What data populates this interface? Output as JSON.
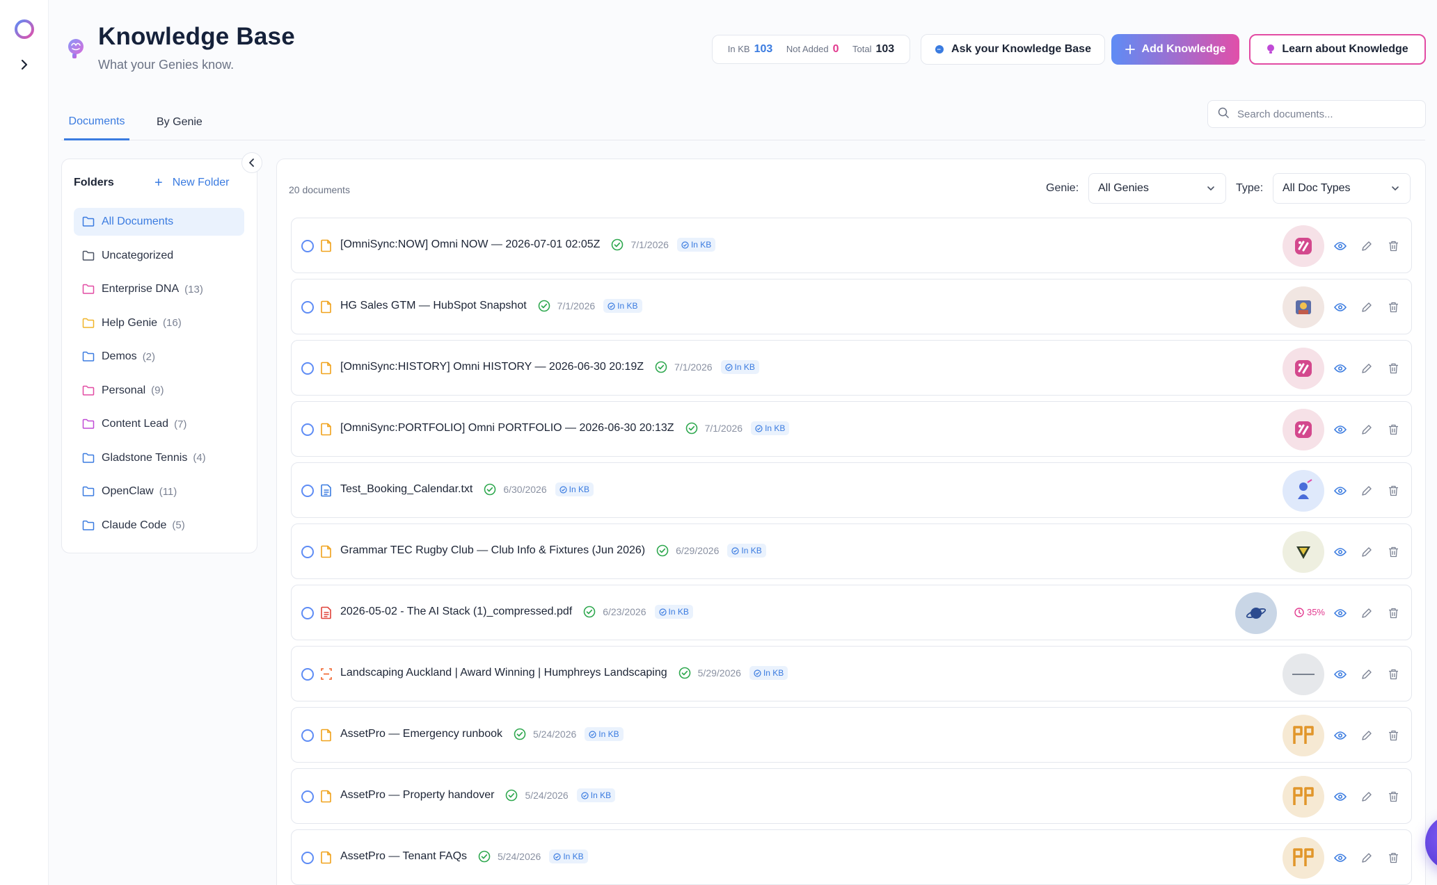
{
  "header": {
    "title": "Knowledge Base",
    "subtitle": "What your Genies know."
  },
  "stats": {
    "in_kb_label": "In KB",
    "in_kb_value": "103",
    "not_added_label": "Not Added",
    "not_added_value": "0",
    "total_label": "Total",
    "total_value": "103"
  },
  "actions": {
    "ask_label": "Ask your Knowledge Base",
    "add_label": "Add Knowledge",
    "learn_label": "Learn about Knowledge"
  },
  "tabs": [
    {
      "label": "Documents",
      "active": true
    },
    {
      "label": "By Genie",
      "active": false
    }
  ],
  "search": {
    "placeholder": "Search documents..."
  },
  "folders": {
    "title": "Folders",
    "new_folder_label": "New Folder",
    "items": [
      {
        "label": "All Documents",
        "count": "",
        "color": "#3a7be0",
        "active": true
      },
      {
        "label": "Uncategorized",
        "count": "",
        "color": "#4a5263",
        "active": false
      },
      {
        "label": "Enterprise DNA",
        "count": "(13)",
        "color": "#e24ba3",
        "active": false
      },
      {
        "label": "Help Genie",
        "count": "(16)",
        "color": "#f0b429",
        "active": false
      },
      {
        "label": "Demos",
        "count": "(2)",
        "color": "#3a7be0",
        "active": false
      },
      {
        "label": "Personal",
        "count": "(9)",
        "color": "#e24ba3",
        "active": false
      },
      {
        "label": "Content Lead",
        "count": "(7)",
        "color": "#c04ad6",
        "active": false
      },
      {
        "label": "Gladstone Tennis",
        "count": "(4)",
        "color": "#3a7be0",
        "active": false
      },
      {
        "label": "OpenClaw",
        "count": "(11)",
        "color": "#3a7be0",
        "active": false
      },
      {
        "label": "Claude Code",
        "count": "(5)",
        "color": "#3a7be0",
        "active": false
      }
    ]
  },
  "docs": {
    "count_label": "20 documents",
    "genie_filter_label": "Genie:",
    "genie_filter_value": "All Genies",
    "type_filter_label": "Type:",
    "type_filter_value": "All Doc Types",
    "in_kb_badge": "In KB",
    "rows": [
      {
        "name": "[OmniSync:NOW] Omni NOW — 2026-07-01 02:05Z",
        "date": "7/1/2026",
        "file_icon": "note-icon",
        "avatar": "omni",
        "progress": ""
      },
      {
        "name": "HG Sales GTM — HubSpot Snapshot",
        "date": "7/1/2026",
        "file_icon": "note-icon",
        "avatar": "hubspot",
        "progress": ""
      },
      {
        "name": "[OmniSync:HISTORY] Omni HISTORY — 2026-06-30 20:19Z",
        "date": "7/1/2026",
        "file_icon": "note-icon",
        "avatar": "omni",
        "progress": ""
      },
      {
        "name": "[OmniSync:PORTFOLIO] Omni PORTFOLIO — 2026-06-30 20:13Z",
        "date": "7/1/2026",
        "file_icon": "note-icon",
        "avatar": "omni",
        "progress": ""
      },
      {
        "name": "Test_Booking_Calendar.txt",
        "date": "6/30/2026",
        "file_icon": "text-file-icon",
        "avatar": "genie",
        "progress": ""
      },
      {
        "name": "Grammar TEC Rugby Club — Club Info & Fixtures (Jun 2026)",
        "date": "6/29/2026",
        "file_icon": "note-icon",
        "avatar": "rugby",
        "progress": ""
      },
      {
        "name": "2026-05-02 - The AI Stack (1)_compressed.pdf",
        "date": "6/23/2026",
        "file_icon": "pdf-icon",
        "avatar": "planet",
        "progress": "35%"
      },
      {
        "name": "Landscaping Auckland | Award Winning | Humphreys Landscaping",
        "date": "5/29/2026",
        "file_icon": "web-scan-icon",
        "avatar": "landscape",
        "progress": ""
      },
      {
        "name": "AssetPro — Emergency runbook",
        "date": "5/24/2026",
        "file_icon": "note-icon",
        "avatar": "assetpro",
        "progress": ""
      },
      {
        "name": "AssetPro — Property handover",
        "date": "5/24/2026",
        "file_icon": "note-icon",
        "avatar": "assetpro",
        "progress": ""
      },
      {
        "name": "AssetPro — Tenant FAQs",
        "date": "5/24/2026",
        "file_icon": "note-icon",
        "avatar": "assetpro",
        "progress": ""
      }
    ]
  }
}
